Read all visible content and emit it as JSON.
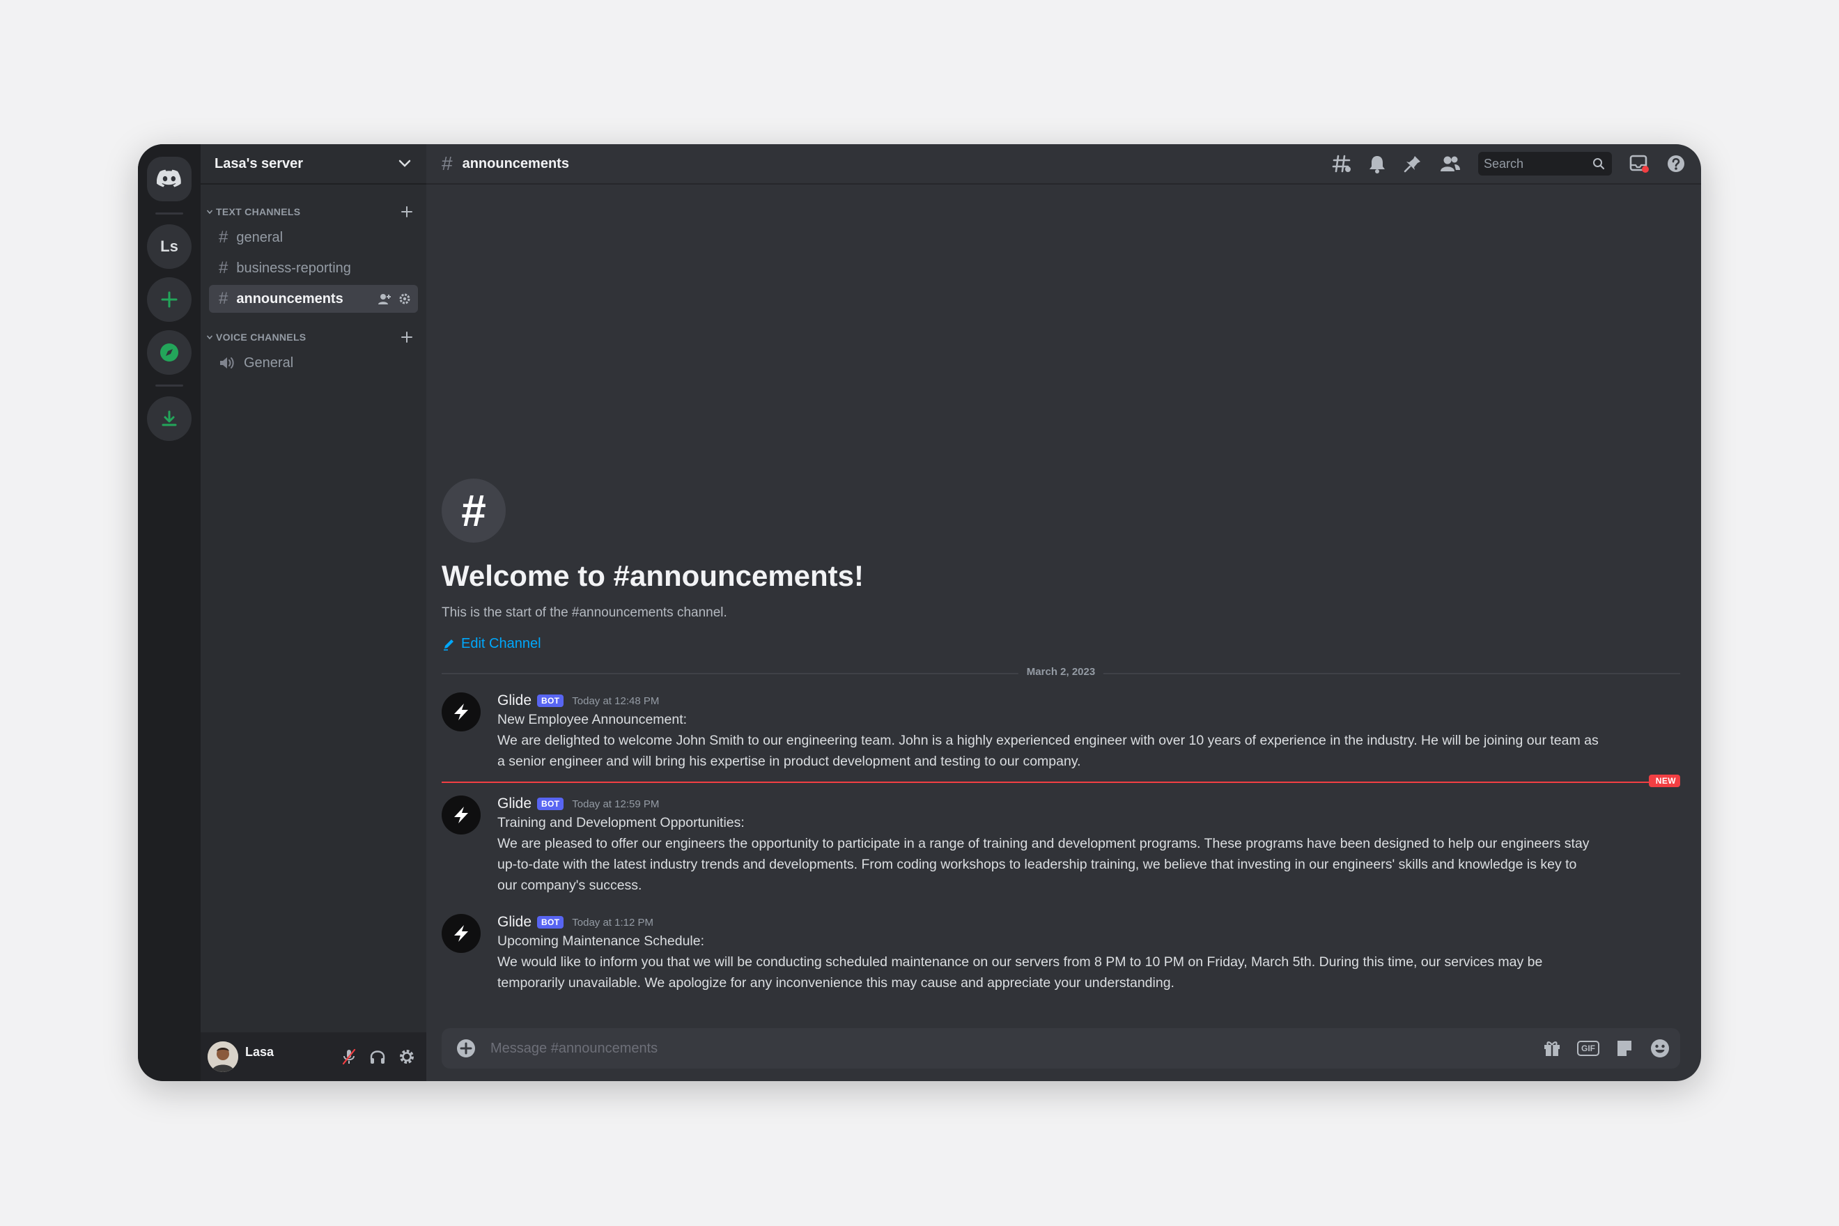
{
  "server": {
    "name": "Lasa's server",
    "rail_initials": "Ls"
  },
  "categories": {
    "text": "TEXT CHANNELS",
    "voice": "VOICE CHANNELS"
  },
  "text_channels": [
    {
      "label": "general"
    },
    {
      "label": "business-reporting"
    },
    {
      "label": "announcements",
      "active": true
    }
  ],
  "voice_channels": [
    {
      "label": "General"
    }
  ],
  "user": {
    "name": "Lasa"
  },
  "topbar": {
    "channel": "announcements",
    "search_placeholder": "Search"
  },
  "welcome": {
    "icon_glyph": "#",
    "title": "Welcome to #announcements!",
    "subtitle": "This is the start of the #announcements channel.",
    "edit_label": "Edit Channel"
  },
  "date_divider": "March 2, 2023",
  "new_badge": "NEW",
  "messages": [
    {
      "author": "Glide",
      "tag": "BOT",
      "time": "Today at 12:48 PM",
      "lines": [
        "New Employee Announcement:",
        "We are delighted to welcome John Smith to our engineering team. John is a highly experienced engineer with over 10 years of experience in the industry. He will be joining our team as",
        "a senior engineer and will bring his expertise in product development and testing to our company."
      ]
    },
    {
      "author": "Glide",
      "tag": "BOT",
      "time": "Today at 12:59 PM",
      "lines": [
        "Training and Development Opportunities:",
        "We are pleased to offer our engineers the opportunity to participate in a range of training and development programs. These programs have been designed to help our engineers stay",
        "up-to-date with the latest industry trends and developments. From coding workshops to leadership training, we believe that investing in our engineers' skills and knowledge is key to",
        "our company's success."
      ]
    },
    {
      "author": "Glide",
      "tag": "BOT",
      "time": "Today at 1:12 PM",
      "lines": [
        "Upcoming Maintenance Schedule:",
        "We would like to inform you that we will be conducting scheduled maintenance on our servers from 8 PM to 10 PM on Friday, March 5th. During this time, our services may be",
        "temporarily unavailable. We apologize for any inconvenience this may cause and appreciate your understanding."
      ]
    }
  ],
  "composer": {
    "placeholder": "Message #announcements",
    "gif_label": "GIF"
  },
  "colors": {
    "accent_blurple": "#5865f2",
    "link": "#00a8fc",
    "new_red": "#f23f43",
    "green": "#23a55a"
  },
  "icons": {
    "rail": [
      "discord-logo-icon",
      "add-server-icon",
      "explore-compass-icon",
      "download-icon"
    ],
    "topbar": [
      "threads-icon",
      "bell-icon",
      "pin-icon",
      "members-icon",
      "search-icon",
      "inbox-icon",
      "help-icon"
    ],
    "composer": [
      "plus-circle-icon",
      "gift-icon",
      "gif-icon",
      "sticker-icon",
      "emoji-icon"
    ],
    "user_bar": [
      "mic-muted-icon",
      "headphones-icon",
      "settings-gear-icon"
    ]
  }
}
